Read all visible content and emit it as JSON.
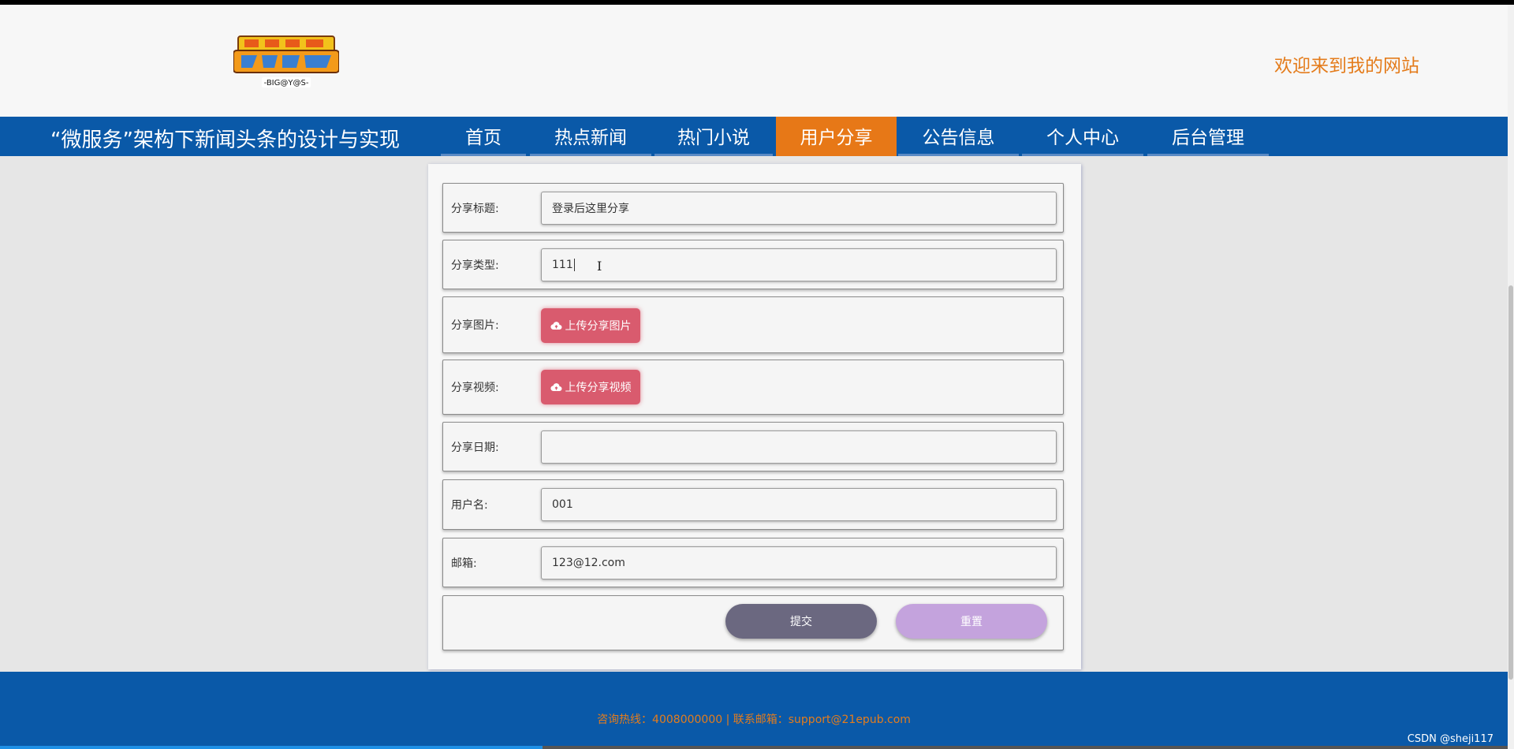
{
  "header": {
    "logo_alt": "BIG@Y@S",
    "logo_caption": "-BIG@Y@S-",
    "welcome": "欢迎来到我的网站"
  },
  "nav": {
    "site_title": "“微服务”架构下新闻头条的设计与实现",
    "items": [
      {
        "label": "首页"
      },
      {
        "label": "热点新闻"
      },
      {
        "label": "热门小说"
      },
      {
        "label": "用户分享",
        "active": true
      },
      {
        "label": "公告信息"
      },
      {
        "label": "个人中心"
      },
      {
        "label": "后台管理"
      }
    ]
  },
  "form": {
    "title_label": "分享标题:",
    "title_value": "登录后这里分享",
    "type_label": "分享类型:",
    "type_value": "111",
    "image_label": "分享图片:",
    "image_button": "上传分享图片",
    "video_label": "分享视频:",
    "video_button": "上传分享视频",
    "date_label": "分享日期:",
    "date_value": "",
    "username_label": "用户名:",
    "username_value": "001",
    "email_label": "邮箱:",
    "email_value": "123@12.com",
    "submit": "提交",
    "reset": "重置"
  },
  "footer": {
    "contact": "咨询热线：4008000000 | 联系邮箱：support@21epub.com"
  },
  "watermark": "CSDN @sheji117",
  "page_load_progress": 0.36,
  "colors": {
    "nav_bg": "#0a59a8",
    "nav_active": "#e77817",
    "accent_text": "#e47c1c",
    "upload_btn": "#d95b6e",
    "submit_btn": "#6b6880",
    "reset_btn": "#c4a3dd"
  },
  "icons": {
    "upload": "cloud-upload-icon",
    "text_cursor": "ibeam-cursor-icon"
  }
}
